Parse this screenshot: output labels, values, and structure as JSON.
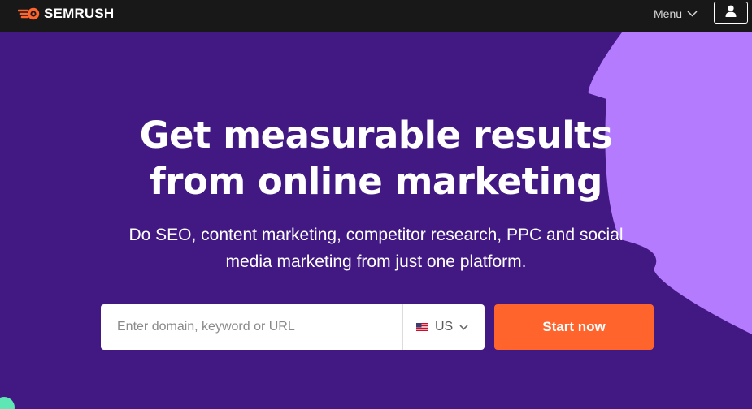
{
  "brand": {
    "name": "SEMRUSH",
    "logo_icon": "semrush-flame-logo-icon",
    "accent": "#ff642d"
  },
  "nav": {
    "menu_label": "Menu",
    "menu_icon": "chevron-down-icon",
    "user_icon": "user-icon"
  },
  "hero": {
    "headline_line1": "Get measurable results",
    "headline_line2": "from online marketing",
    "subtitle_line1": "Do SEO, content marketing, competitor research, PPC and social",
    "subtitle_line2": "media marketing from just one platform."
  },
  "search": {
    "placeholder": "Enter domain, keyword or URL",
    "value": "",
    "country_code": "US",
    "country_flag_icon": "us-flag-icon",
    "dropdown_icon": "chevron-down-icon",
    "submit_label": "Start now"
  },
  "colors": {
    "background": "#421983",
    "topbar": "#181818",
    "blob": "#b57bff",
    "button": "#ff642d",
    "corner_shape": "#5ee6b4"
  }
}
